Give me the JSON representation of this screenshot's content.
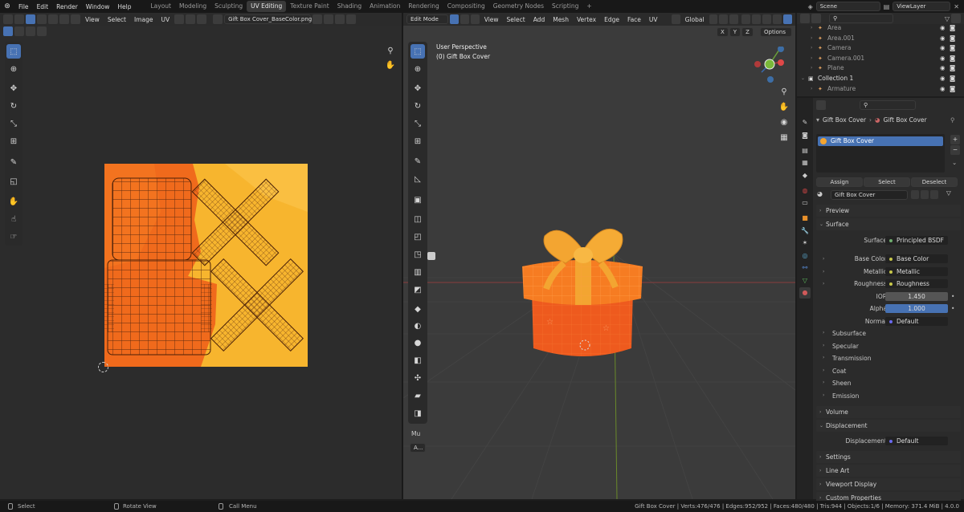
{
  "topbar": {
    "menus": [
      "File",
      "Edit",
      "Render",
      "Window",
      "Help"
    ],
    "workspaces": [
      "Layout",
      "Modeling",
      "Sculpting",
      "UV Editing",
      "Texture Paint",
      "Shading",
      "Animation",
      "Rendering",
      "Compositing",
      "Geometry Nodes",
      "Scripting"
    ],
    "active_workspace": "UV Editing",
    "add_tab": "+",
    "scene": "Scene",
    "view_layer": "ViewLayer"
  },
  "uv_editor": {
    "menus": [
      "View",
      "Select",
      "Image",
      "UV"
    ],
    "image_name": "Gift Box Cover_BaseColor.png"
  },
  "viewport": {
    "mode": "Edit Mode",
    "menus": [
      "View",
      "Select",
      "Add",
      "Mesh",
      "Vertex",
      "Edge",
      "Face",
      "UV"
    ],
    "transform_orientation": "Global",
    "axes": [
      "X",
      "Y",
      "Z"
    ],
    "options_label": "Options",
    "view_title": "User Perspective",
    "object_label": "(0) Gift Box Cover",
    "gizmo": {
      "x": "X",
      "y": "Y",
      "z": "Z"
    },
    "redo_panel": "Mu",
    "last_op": "A..."
  },
  "outliner": {
    "items": [
      {
        "name": "Area",
        "indent": 1
      },
      {
        "name": "Area.001",
        "indent": 1
      },
      {
        "name": "Camera",
        "indent": 1
      },
      {
        "name": "Camera.001",
        "indent": 1
      },
      {
        "name": "Plane",
        "indent": 1
      },
      {
        "name": "Collection 1",
        "indent": 0
      },
      {
        "name": "Armature",
        "indent": 1
      }
    ]
  },
  "properties": {
    "breadcrumb_object": "Gift Box Cover",
    "breadcrumb_material": "Gift Box Cover",
    "material_slot": "Gift Box Cover",
    "buttons": {
      "assign": "Assign",
      "select": "Select",
      "deselect": "Deselect"
    },
    "material_name": "Gift Box Cover",
    "sections": {
      "preview": "Preview",
      "surface": "Surface",
      "volume": "Volume",
      "displacement": "Displacement",
      "settings": "Settings",
      "line_art": "Line Art",
      "viewport_display": "Viewport Display",
      "custom_properties": "Custom Properties"
    },
    "surface_rows": [
      {
        "label": "Surface",
        "value": "Principled BSDF"
      },
      {
        "label": "Base Color",
        "value": "Base Color"
      },
      {
        "label": "Metallic",
        "value": "Metallic"
      },
      {
        "label": "Roughness",
        "value": "Roughness"
      },
      {
        "label": "IOR",
        "value": "1.450"
      },
      {
        "label": "Alpha",
        "value": "1.000"
      },
      {
        "label": "Normal",
        "value": "Default"
      }
    ],
    "subpanels": [
      "Subsurface",
      "Specular",
      "Transmission",
      "Coat",
      "Sheen",
      "Emission"
    ],
    "displacement_row": {
      "label": "Displacement",
      "value": "Default"
    }
  },
  "statusbar": {
    "select": "Select",
    "rotate": "Rotate View",
    "call_menu": "Call Menu",
    "stats": "Gift Box Cover | Verts:476/476 | Edges:952/952 | Faces:480/480 | Tris:944 | Objects:1/6 | Memory: 371.4 MiB | 4.0.0"
  },
  "colors": {
    "accent": "#4772b3",
    "uv_orange": "#f06a1c",
    "uv_yellow": "#f7b52e",
    "gift_ribbon": "#f3a531",
    "background": "#1d1d1d"
  }
}
